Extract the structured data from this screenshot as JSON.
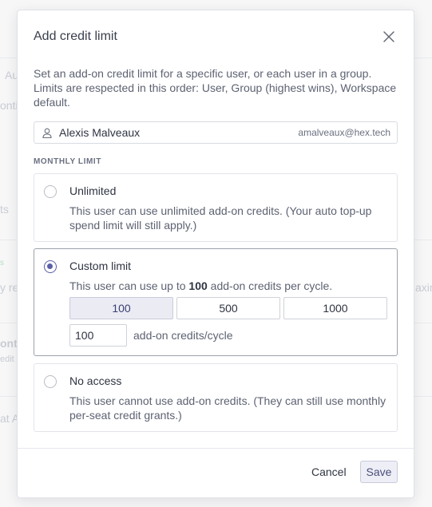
{
  "background": {
    "fragments": [
      "Au",
      "onti",
      "ts",
      "s",
      "y ret",
      "axim",
      "ontr",
      "edit a",
      "at A"
    ]
  },
  "modal": {
    "title": "Add credit limit",
    "description": "Set an add-on credit limit for a specific user, or each user in a group. Limits are respected in this order: User, Group (highest wins), Workspace default.",
    "user": {
      "name": "Alexis Malveaux",
      "email": "amalveaux@hex.tech",
      "icon": "user-icon"
    },
    "section_label": "MONTHLY LIMIT",
    "options": {
      "unlimited": {
        "title": "Unlimited",
        "description": "This user can use unlimited add-on credits. (Your auto top-up spend limit will still apply.)",
        "selected": false
      },
      "custom": {
        "title": "Custom limit",
        "description_prefix": "This user can use up to",
        "description_amount": "100",
        "description_suffix": "add-on credits per cycle.",
        "presets": [
          "100",
          "500",
          "1000"
        ],
        "active_preset": "100",
        "input_value": "100",
        "unit_label": "add-on credits/cycle",
        "selected": true
      },
      "no_access": {
        "title": "No access",
        "description": "This user cannot use add-on credits. (They can still use monthly per-seat credit grants.)",
        "selected": false
      }
    },
    "footer": {
      "cancel_label": "Cancel",
      "save_label": "Save"
    }
  },
  "colors": {
    "accent": "#5a5fa8",
    "border": "#e2e4e9",
    "text": "#2f3442",
    "muted": "#5d6272"
  }
}
